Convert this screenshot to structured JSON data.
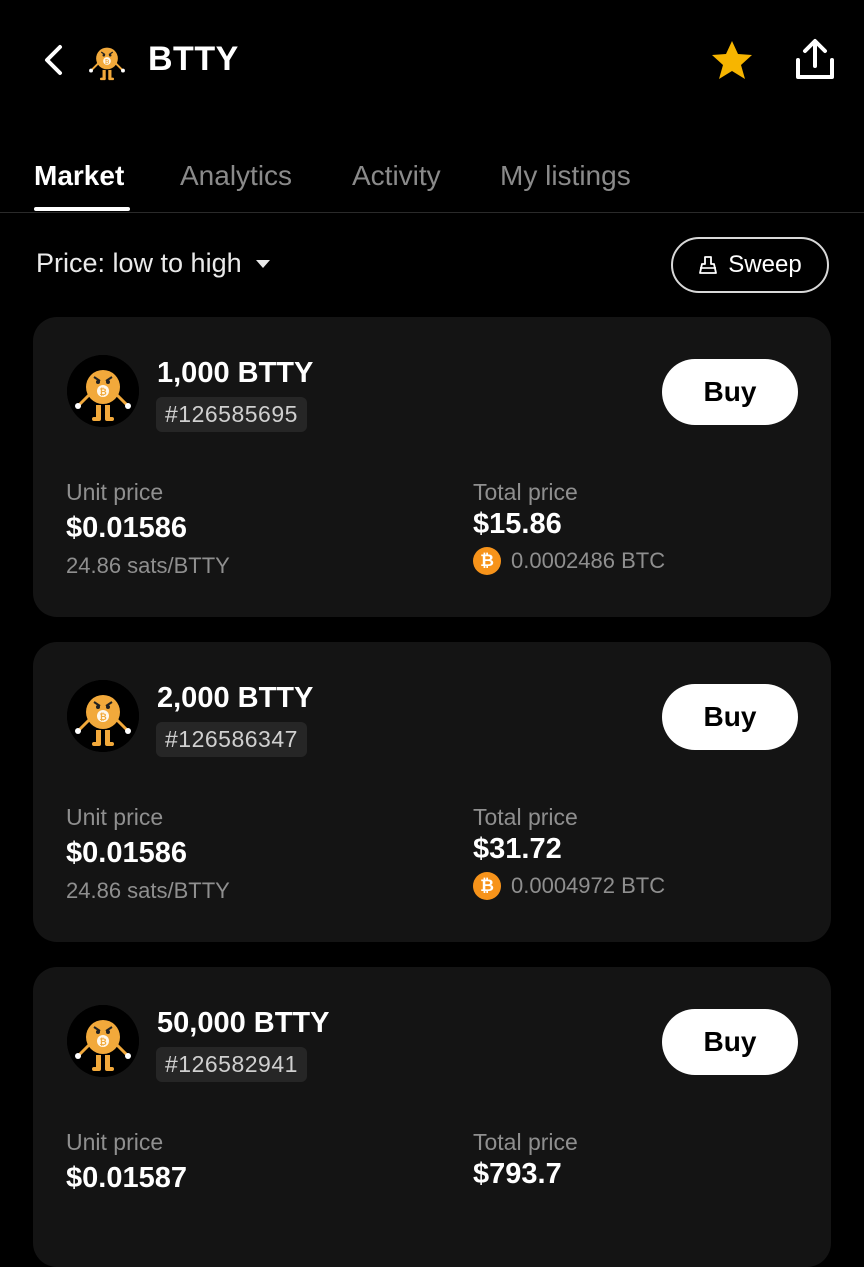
{
  "header": {
    "title": "BTTY",
    "back_icon": "chevron-left-icon",
    "favorite_icon": "star-icon",
    "share_icon": "share-icon",
    "star_color": "#f7b500"
  },
  "tabs": [
    {
      "label": "Market",
      "active": true
    },
    {
      "label": "Analytics",
      "active": false
    },
    {
      "label": "Activity",
      "active": false
    },
    {
      "label": "My listings",
      "active": false
    }
  ],
  "toolbar": {
    "sort_label": "Price: low to high",
    "sweep_label": "Sweep"
  },
  "listings": [
    {
      "amount": "1,000 BTTY",
      "inscription": "#126585695",
      "buy_label": "Buy",
      "unit_price_label": "Unit price",
      "unit_price": "$0.01586",
      "sats": "24.86 sats/BTTY",
      "total_price_label": "Total price",
      "total_price": "$15.86",
      "total_btc": "0.0002486 BTC"
    },
    {
      "amount": "2,000 BTTY",
      "inscription": "#126586347",
      "buy_label": "Buy",
      "unit_price_label": "Unit price",
      "unit_price": "$0.01586",
      "sats": "24.86 sats/BTTY",
      "total_price_label": "Total price",
      "total_price": "$31.72",
      "total_btc": "0.0004972 BTC"
    },
    {
      "amount": "50,000 BTTY",
      "inscription": "#126582941",
      "buy_label": "Buy",
      "unit_price_label": "Unit price",
      "unit_price": "$0.01587",
      "total_price_label": "Total price",
      "total_price": "$793.7"
    }
  ],
  "colors": {
    "background": "#000000",
    "card": "#141414",
    "bitcoin": "#f7931a",
    "mascot": "#f2a93b"
  }
}
